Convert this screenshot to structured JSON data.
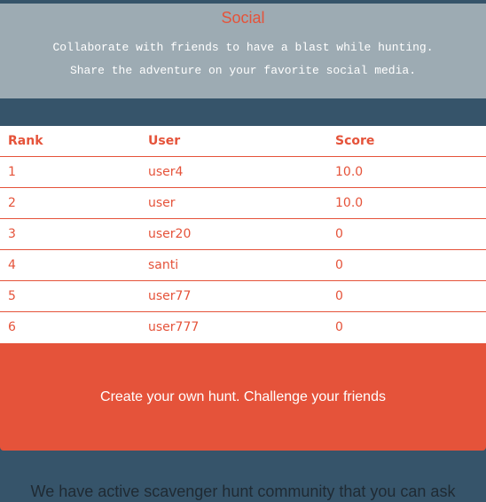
{
  "social": {
    "title": "Social",
    "line1": "Collaborate with friends to have a blast while hunting.",
    "line2": "Share the adventure on your favorite social media."
  },
  "leaderboard": {
    "headers": {
      "rank": "Rank",
      "user": "User",
      "score": "Score"
    },
    "rows": [
      {
        "rank": "1",
        "user": "user4",
        "score": "10.0"
      },
      {
        "rank": "2",
        "user": "user",
        "score": "10.0"
      },
      {
        "rank": "3",
        "user": "user20",
        "score": "0"
      },
      {
        "rank": "4",
        "user": "santi",
        "score": "0"
      },
      {
        "rank": "5",
        "user": "user77",
        "score": "0"
      },
      {
        "rank": "6",
        "user": "user777",
        "score": "0"
      }
    ]
  },
  "cta": {
    "label": "Create your own hunt. Challenge your friends"
  },
  "community": {
    "text": "We have active scavenger hunt community that you can ask"
  },
  "colors": {
    "accent": "#e5533a",
    "hero_background": "#9dabb3",
    "page_background": "#36546a"
  }
}
